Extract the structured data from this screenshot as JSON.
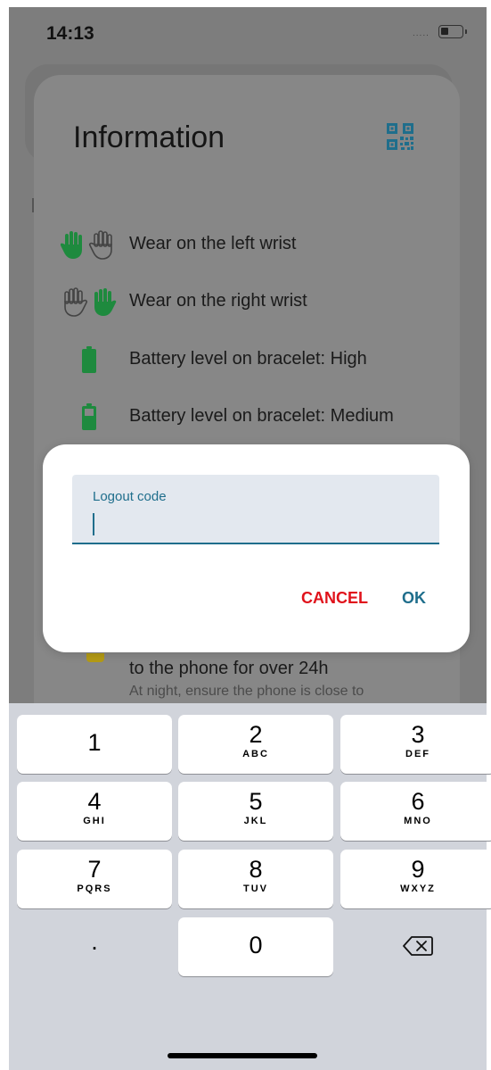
{
  "status_bar": {
    "time": "14:13",
    "signal_dots": "....."
  },
  "sheet": {
    "title": "Information",
    "rows": [
      {
        "label": "Wear on the left wrist",
        "icon": "hands-left-icon"
      },
      {
        "label": "Wear on the right wrist",
        "icon": "hands-right-icon"
      },
      {
        "label": "Battery level on bracelet: High",
        "icon": "battery-high-icon"
      },
      {
        "label": "Battery level on bracelet: Medium",
        "icon": "battery-medium-icon"
      }
    ],
    "under_dialog": {
      "line1": "to the phone for over 24h",
      "line2": "At night, ensure the phone is close to"
    }
  },
  "dialog": {
    "field_label": "Logout code",
    "field_value": "",
    "cancel_label": "CANCEL",
    "ok_label": "OK"
  },
  "keypad": {
    "keys": [
      {
        "num": "1",
        "letters": ""
      },
      {
        "num": "2",
        "letters": "ABC"
      },
      {
        "num": "3",
        "letters": "DEF"
      },
      {
        "num": "4",
        "letters": "GHI"
      },
      {
        "num": "5",
        "letters": "JKL"
      },
      {
        "num": "6",
        "letters": "MNO"
      },
      {
        "num": "7",
        "letters": "PQRS"
      },
      {
        "num": "8",
        "letters": "TUV"
      },
      {
        "num": "9",
        "letters": "WXYZ"
      },
      {
        "num": "0",
        "letters": ""
      }
    ],
    "dot_label": ".",
    "delete_icon": "backspace-icon"
  },
  "colors": {
    "accent": "#1f6e8c",
    "cancel": "#e0121b",
    "active_hand": "#1e8a3e",
    "battery": "#1e8a3e"
  }
}
